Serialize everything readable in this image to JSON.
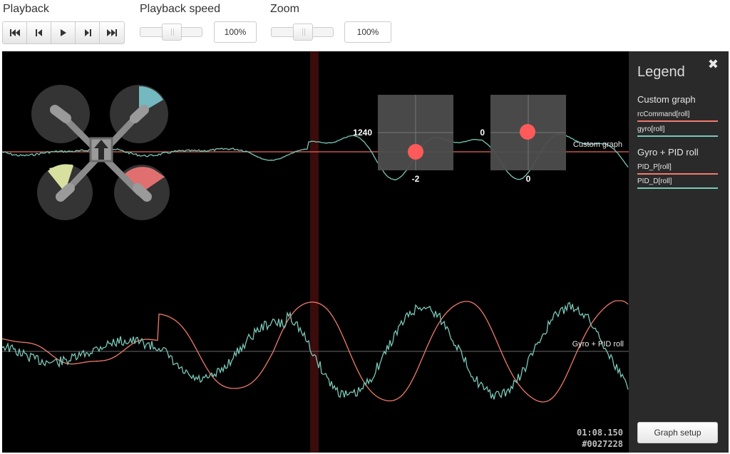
{
  "toolbar": {
    "playback_label": "Playback",
    "playback_buttons": [
      {
        "icon": "skip-to-start-icon"
      },
      {
        "icon": "step-back-icon"
      },
      {
        "icon": "play-icon"
      },
      {
        "icon": "step-forward-icon"
      },
      {
        "icon": "skip-to-end-icon"
      }
    ],
    "speed_label": "Playback speed",
    "speed_value": "100%",
    "speed_slider_fraction": 0.5,
    "zoom_label": "Zoom",
    "zoom_value": "100%",
    "zoom_slider_fraction": 0.5
  },
  "graph": {
    "custom_graph_label": "Custom graph",
    "gyro_pid_label": "Gyro + PID roll",
    "stick_left_top_value": "1240",
    "stick_left_bottom_value": "-2",
    "stick_right_top_value": "0",
    "stick_right_bottom_value": "0",
    "time": "01:08.150",
    "frame": "#0027228",
    "colors": {
      "red_series": "#f07a6c",
      "teal_series": "#7ac8b8",
      "cursor": "#3a0c0c",
      "stick_dot": "#ff5a5a",
      "motor_teal": "#74b8c0",
      "motor_yellow": "#d8e0a0",
      "motor_red": "#e07070"
    }
  },
  "legend": {
    "title": "Legend",
    "groups": [
      {
        "title": "Custom graph",
        "items": [
          {
            "label": "rcCommand[roll]",
            "color": "#f07a6c"
          },
          {
            "label": "gyro[roll]",
            "color": "#7ac8b8"
          }
        ]
      },
      {
        "title": "Gyro + PID roll",
        "items": [
          {
            "label": "PID_P[roll]",
            "color": "#f07a6c"
          },
          {
            "label": "PID_D[roll]",
            "color": "#7ac8b8"
          }
        ]
      }
    ],
    "setup_button": "Graph setup"
  }
}
